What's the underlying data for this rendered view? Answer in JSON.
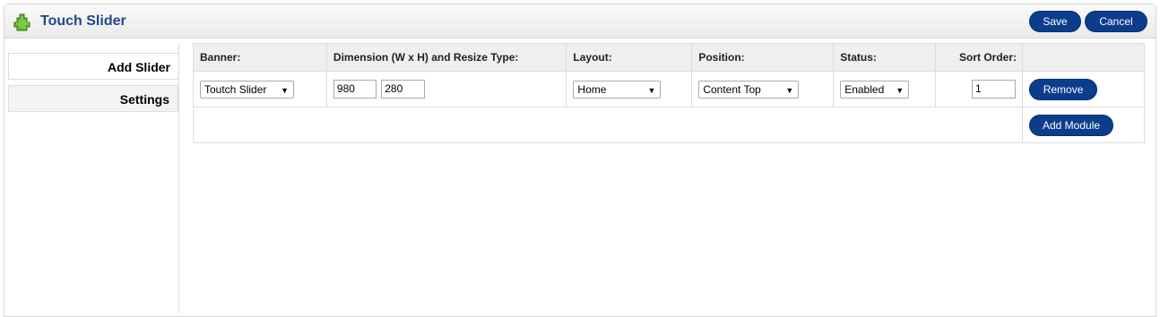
{
  "header": {
    "title": "Touch Slider",
    "icon": "puzzle-icon",
    "save_label": "Save",
    "cancel_label": "Cancel",
    "accent_color": "#0b3d8c"
  },
  "tabs": [
    {
      "label": "Add Slider",
      "active": true
    },
    {
      "label": "Settings",
      "active": false
    }
  ],
  "table": {
    "headers": {
      "banner": "Banner:",
      "dimension": "Dimension (W x H) and Resize Type:",
      "layout": "Layout:",
      "position": "Position:",
      "status": "Status:",
      "sort_order": "Sort Order:"
    },
    "rows": [
      {
        "banner": "Toutch Slider",
        "width": "980",
        "height": "280",
        "layout": "Home",
        "position": "Content Top",
        "status": "Enabled",
        "sort_order": "1",
        "remove_label": "Remove"
      }
    ],
    "add_module_label": "Add Module"
  }
}
